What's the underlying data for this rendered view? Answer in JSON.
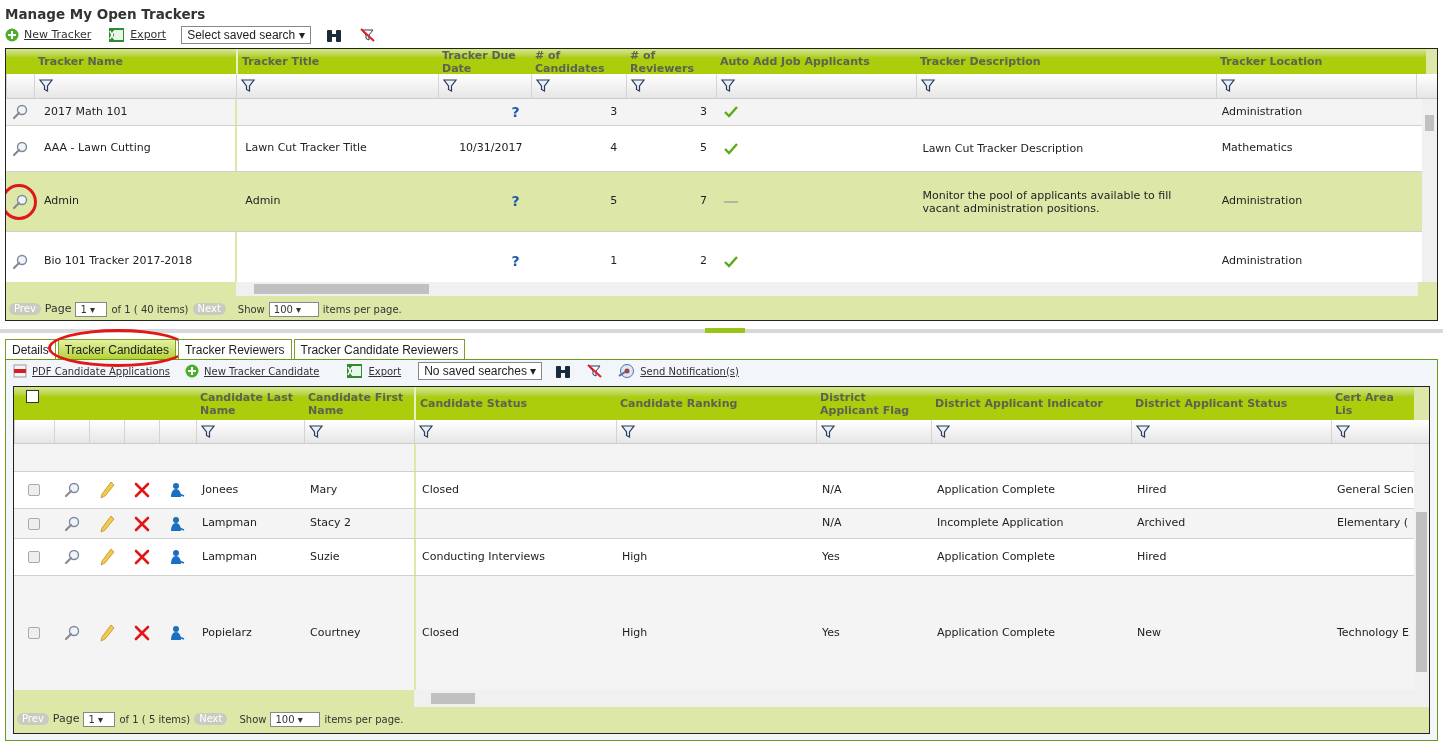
{
  "page_title": "Manage My Open Trackers",
  "toolbar": {
    "new_label": "New Tracker",
    "export_label": "Export",
    "saved_search": "Select saved search ▾"
  },
  "trackers": {
    "columns": [
      "Tracker Name",
      "Tracker Title",
      "Tracker Due Date",
      "# of Candidates",
      "# of Reviewers",
      "Auto Add Job Applicants",
      "Tracker Description",
      "Tracker Location"
    ],
    "rows": [
      {
        "name": "2017 Math 101",
        "title": "",
        "due": "?",
        "due_unknown": true,
        "candidates": "3",
        "reviewers": "3",
        "auto_add": true,
        "description": "",
        "location": "Administration",
        "selected": false,
        "circled": false
      },
      {
        "name": "AAA - Lawn Cutting",
        "title": "Lawn Cut Tracker Title",
        "due": "10/31/2017",
        "due_unknown": false,
        "candidates": "4",
        "reviewers": "5",
        "auto_add": true,
        "description": "Lawn Cut Tracker Description",
        "location": "Mathematics",
        "selected": false,
        "circled": false
      },
      {
        "name": "Admin",
        "title": "Admin",
        "due": "?",
        "due_unknown": true,
        "candidates": "5",
        "reviewers": "7",
        "auto_add": false,
        "description": "Monitor the pool of applicants available to fill vacant administration positions.",
        "location": "Administration",
        "selected": true,
        "circled": true
      },
      {
        "name": "Bio 101 Tracker 2017-2018",
        "title": "",
        "due": "?",
        "due_unknown": true,
        "candidates": "1",
        "reviewers": "2",
        "auto_add": true,
        "description": "",
        "location": "Administration",
        "selected": false,
        "circled": false
      }
    ],
    "pager": {
      "prev": "Prev",
      "page_label": "Page",
      "page": "1 ▾",
      "of": "of 1 ( 40 items)",
      "next": "Next",
      "show": "Show",
      "per_page": "100 ▾",
      "per_page_label": "items per page."
    }
  },
  "tabs": [
    {
      "label": "Details",
      "selected": false,
      "circled": false
    },
    {
      "label": "Tracker Candidates",
      "selected": true,
      "circled": true
    },
    {
      "label": "Tracker Reviewers",
      "selected": false,
      "circled": false
    },
    {
      "label": "Tracker Candidate Reviewers",
      "selected": false,
      "circled": false
    }
  ],
  "candidate_toolbar": {
    "pdf_label": "PDF Candidate Applications",
    "new_label": "New Tracker Candidate",
    "export_label": "Export",
    "saved_search": "No saved searches ▾",
    "notify_label": "Send Notification(s)"
  },
  "candidates": {
    "columns": [
      "Candidate Last Name",
      "Candidate First Name",
      "Candidate Status",
      "Candidate Ranking",
      "District Applicant Flag",
      "District Applicant Indicator",
      "District Applicant Status",
      "Cert Area Lis"
    ],
    "rows": [
      {
        "checked": false,
        "last": "Jonees",
        "first": "Mary",
        "status": "Closed",
        "ranking": "",
        "flag": "N/A",
        "indicator": "Application Complete",
        "dstatus": "Hired",
        "cert": "General Scien"
      },
      {
        "checked": false,
        "last": "Lampman",
        "first": "Stacy 2",
        "status": "",
        "ranking": "",
        "flag": "N/A",
        "indicator": "Incomplete Application",
        "dstatus": "Archived",
        "cert": "Elementary ("
      },
      {
        "checked": false,
        "last": "Lampman",
        "first": "Suzie",
        "status": "Conducting Interviews",
        "ranking": "High",
        "flag": "Yes",
        "indicator": "Application Complete",
        "dstatus": "Hired",
        "cert": ""
      },
      {
        "checked": false,
        "last": "Popielarz",
        "first": "Courtney",
        "status": "Closed",
        "ranking": "High",
        "flag": "Yes",
        "indicator": "Application Complete",
        "dstatus": "New",
        "cert": "Technology E"
      }
    ],
    "pager": {
      "prev": "Prev",
      "page_label": "Page",
      "page": "1 ▾",
      "of": "of 1 ( 5 items)",
      "next": "Next",
      "show": "Show",
      "per_page": "100 ▾",
      "per_page_label": "items per page."
    }
  }
}
